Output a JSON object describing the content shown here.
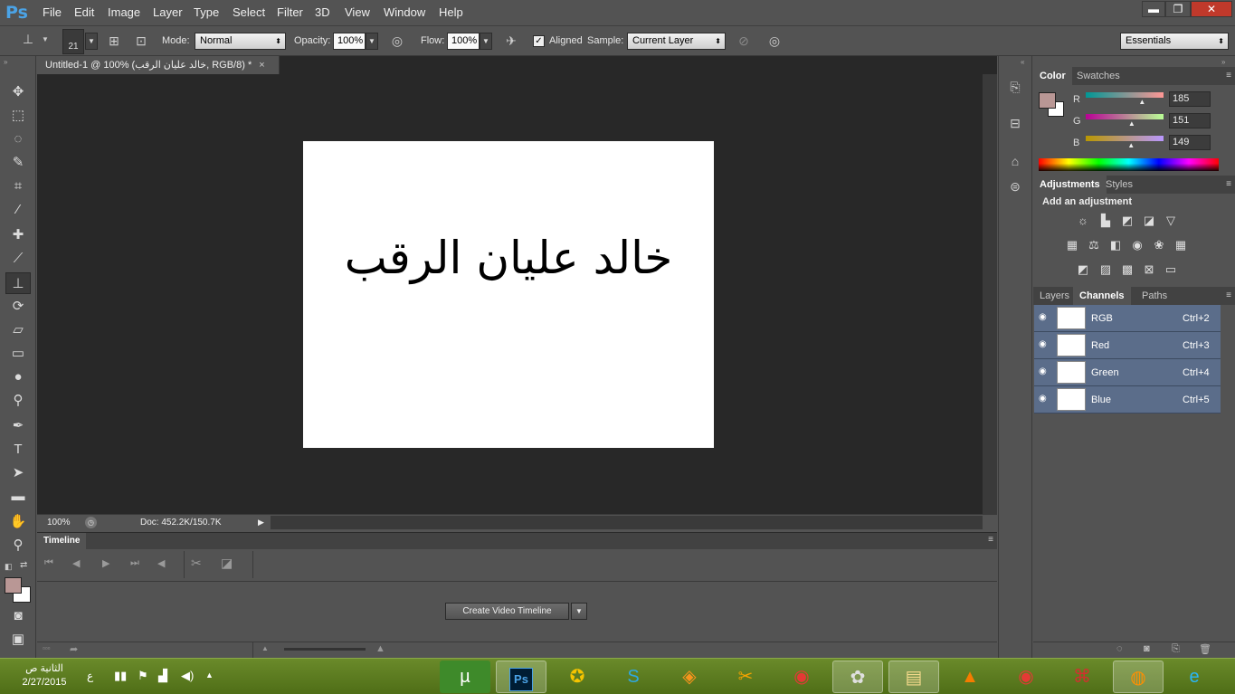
{
  "app": {
    "logo": "Ps"
  },
  "menu": [
    "File",
    "Edit",
    "Image",
    "Layer",
    "Type",
    "Select",
    "Filter",
    "3D",
    "View",
    "Window",
    "Help"
  ],
  "window_controls": {
    "minimize": "▬",
    "restore": "❐",
    "close": "✕"
  },
  "options": {
    "brush_size": "21",
    "mode_label": "Mode:",
    "mode_value": "Normal",
    "opacity_label": "Opacity:",
    "opacity_value": "100%",
    "flow_label": "Flow:",
    "flow_value": "100%",
    "aligned_label": "Aligned",
    "aligned_checked": true,
    "sample_label": "Sample:",
    "sample_value": "Current Layer",
    "workspace": "Essentials"
  },
  "document": {
    "tab_title": "Untitled-1 @ 100% (خالد عليان الرقب, RGB/8) *",
    "canvas_text": "خالد عليان الرقب",
    "zoom": "100%",
    "doc_info": "Doc: 452.2K/150.7K"
  },
  "timeline": {
    "title": "Timeline",
    "create_button": "Create Video Timeline"
  },
  "color_panel": {
    "tabs": [
      "Color",
      "Swatches"
    ],
    "foreground": "#b99795",
    "channels": [
      {
        "label": "R",
        "value": "185",
        "level": 0.725
      },
      {
        "label": "G",
        "value": "151",
        "level": 0.592
      },
      {
        "label": "B",
        "value": "149",
        "level": 0.584
      }
    ]
  },
  "adjustments_panel": {
    "tabs": [
      "Adjustments",
      "Styles"
    ],
    "heading": "Add an adjustment",
    "icons_row1": [
      "brightness-contrast-icon",
      "levels-icon",
      "curves-icon",
      "exposure-icon",
      "vibrance-icon"
    ],
    "icons_row2": [
      "hue-saturation-icon",
      "color-balance-icon",
      "black-white-icon",
      "photo-filter-icon",
      "channel-mixer-icon",
      "color-lookup-icon"
    ],
    "icons_row3": [
      "invert-icon",
      "posterize-icon",
      "threshold-icon",
      "selective-color-icon",
      "gradient-map-icon"
    ]
  },
  "layers_panel": {
    "tabs": [
      "Layers",
      "Channels",
      "Paths"
    ],
    "channels": [
      {
        "name": "RGB",
        "shortcut": "Ctrl+2"
      },
      {
        "name": "Red",
        "shortcut": "Ctrl+3"
      },
      {
        "name": "Green",
        "shortcut": "Ctrl+4"
      },
      {
        "name": "Blue",
        "shortcut": "Ctrl+5"
      }
    ]
  },
  "taskbar": {
    "time": "الثانية ص",
    "date": "2/27/2015",
    "lang": "ع",
    "apps": [
      "utorrent-icon",
      "photoshop-icon",
      "app-icon",
      "skype-icon",
      "app-icon",
      "app-icon",
      "chrome-icon",
      "app-icon",
      "folder-icon",
      "vlc-icon",
      "chrome-icon",
      "acrobat-icon",
      "firefox-icon",
      "ie-icon"
    ]
  }
}
